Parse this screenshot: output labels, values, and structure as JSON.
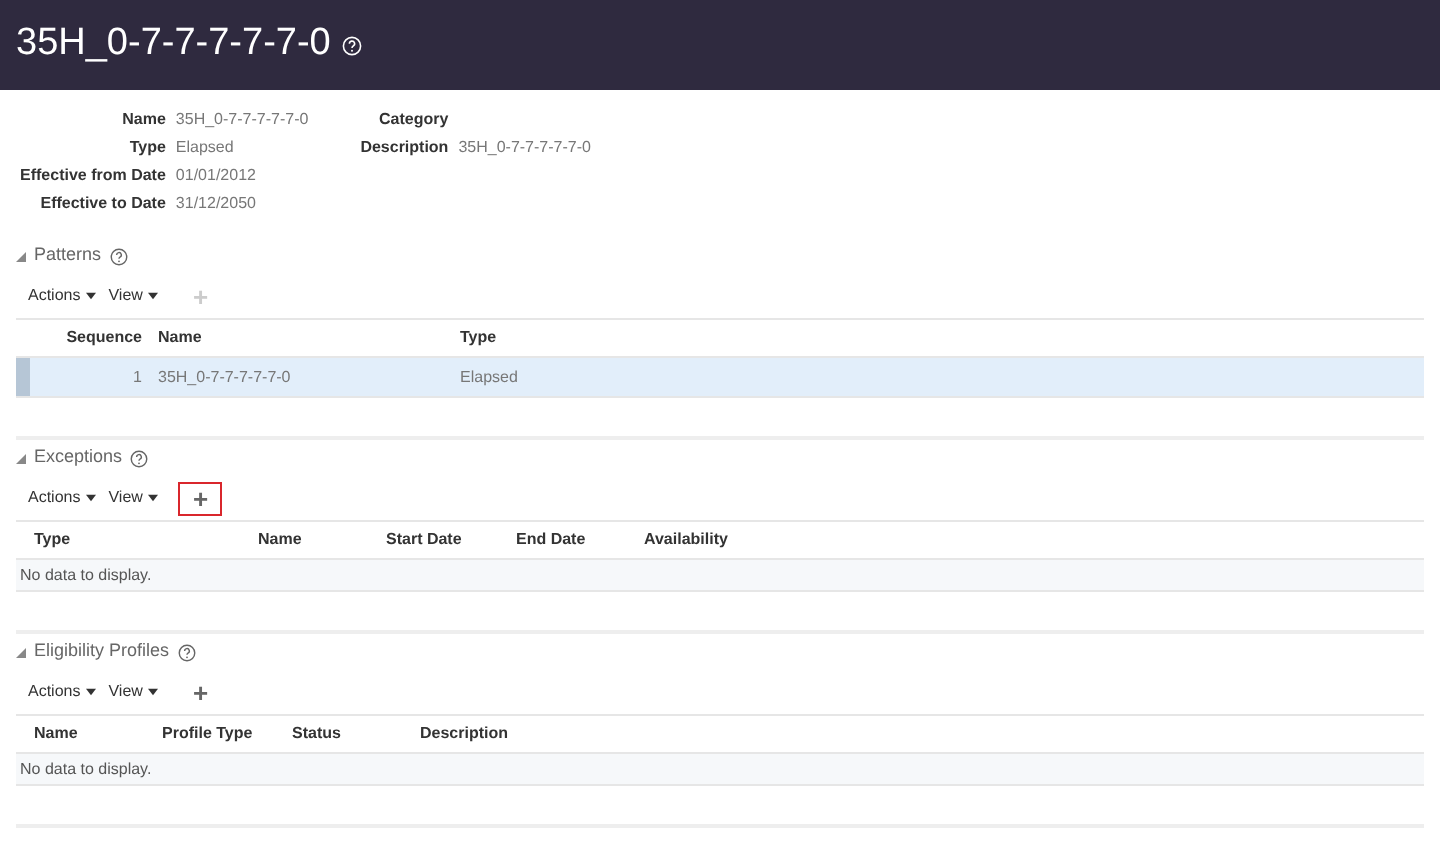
{
  "header": {
    "title": "35H_0-7-7-7-7-7-0"
  },
  "details": {
    "left": [
      {
        "label": "Name",
        "value": "35H_0-7-7-7-7-7-0"
      },
      {
        "label": "Type",
        "value": "Elapsed"
      },
      {
        "label": "Effective from Date",
        "value": "01/01/2012"
      },
      {
        "label": "Effective to Date",
        "value": "31/12/2050"
      }
    ],
    "right": [
      {
        "label": "Category"
      },
      {
        "label": "Description",
        "value": "35H_0-7-7-7-7-7-0"
      }
    ]
  },
  "sections": [
    {
      "title": "Patterns",
      "expanded": true,
      "toolbar": {
        "actions": "Actions",
        "view": "View",
        "add": "+",
        "add_disabled": true,
        "add_highlighted": false
      },
      "columns": [
        {
          "label": "Sequence",
          "kind": "number"
        },
        {
          "label": "Name",
          "kind": "text"
        },
        {
          "label": "Type",
          "kind": "text"
        }
      ],
      "rows": [
        {
          "selected": true,
          "cells": [
            "1",
            "35H_0-7-7-7-7-7-0",
            "Elapsed"
          ]
        }
      ]
    },
    {
      "title": "Exceptions",
      "expanded": true,
      "toolbar": {
        "actions": "Actions",
        "view": "View",
        "add": "+",
        "add_disabled": false,
        "add_highlighted": true
      },
      "columns": [
        {
          "label": "Type",
          "kind": "text"
        },
        {
          "label": "Name",
          "kind": "text"
        },
        {
          "label": "Start Date",
          "kind": "date"
        },
        {
          "label": "End Date",
          "kind": "date"
        },
        {
          "label": "Availability",
          "kind": "text"
        }
      ],
      "empty_text": "No data to display."
    },
    {
      "title": "Eligibility Profiles",
      "expanded": true,
      "toolbar": {
        "actions": "Actions",
        "view": "View",
        "add": "+",
        "add_disabled": false,
        "add_highlighted": false
      },
      "columns": [
        {
          "label": "Name",
          "kind": "text"
        },
        {
          "label": "Profile Type",
          "kind": "text"
        },
        {
          "label": "Status",
          "kind": "text"
        },
        {
          "label": "Description",
          "kind": "text"
        }
      ],
      "empty_text": "No data to display."
    }
  ]
}
